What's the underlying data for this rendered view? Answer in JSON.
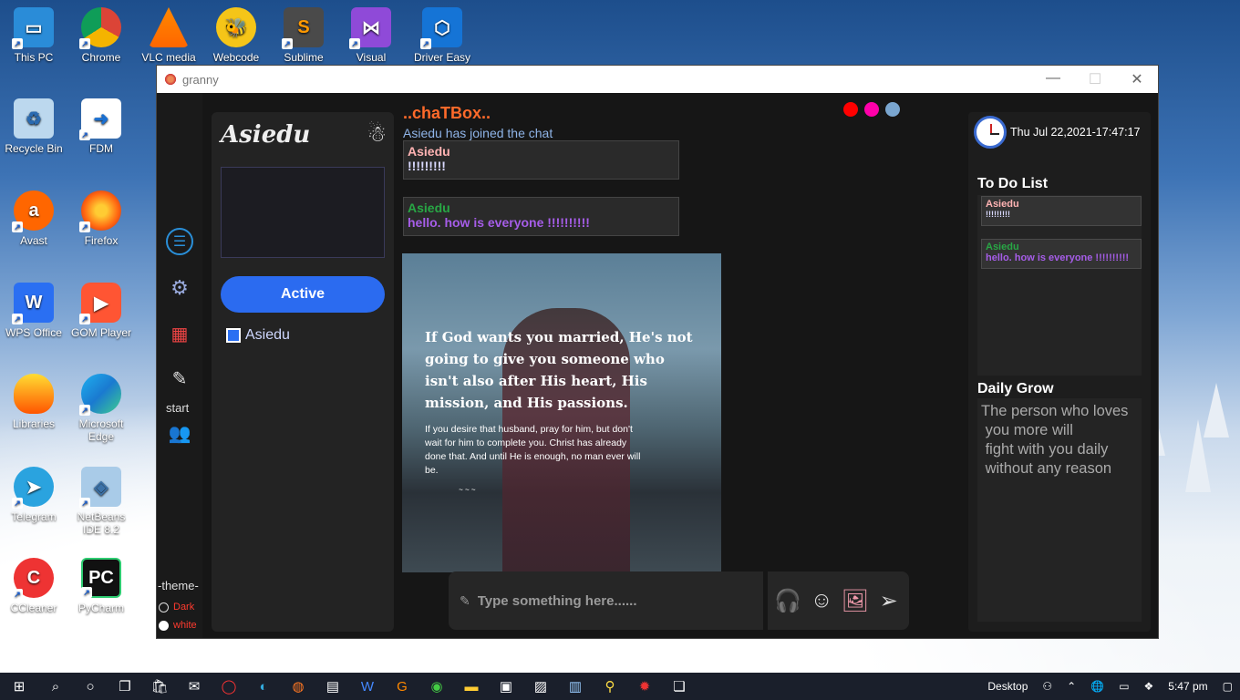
{
  "desktop": {
    "icons": [
      {
        "label": "This PC"
      },
      {
        "label": "Chrome"
      },
      {
        "label": "VLC media"
      },
      {
        "label": "Webcode"
      },
      {
        "label": "Sublime"
      },
      {
        "label": "Visual"
      },
      {
        "label": "Driver Easy"
      },
      {
        "label": "Recycle Bin"
      },
      {
        "label": "FDM"
      },
      {
        "label": "Avast"
      },
      {
        "label": "Firefox"
      },
      {
        "label": "WPS Office"
      },
      {
        "label": "GOM Player"
      },
      {
        "label": "Libraries"
      },
      {
        "label": "Microsoft Edge"
      },
      {
        "label": "Telegram"
      },
      {
        "label": "NetBeans IDE 8.2"
      },
      {
        "label": "CCleaner"
      },
      {
        "label": "PyCharm"
      }
    ]
  },
  "window": {
    "title": "granny"
  },
  "leftbar": {
    "start_label": "start",
    "theme_label": "-theme-",
    "theme_dark": "Dark",
    "theme_white": "white"
  },
  "userpanel": {
    "username": "Asiedu",
    "active_label": "Active",
    "online_users": [
      "Asiedu"
    ]
  },
  "chat": {
    "title": "..chaTBox..",
    "joined_text": "Asiedu has joined the chat",
    "messages": [
      {
        "sender": "Asiedu",
        "text": "!!!!!!!!!",
        "sender_color": "#ffb3b3",
        "text_color": "#d9d9ff"
      },
      {
        "sender": "Asiedu",
        "text": "hello. how is everyone !!!!!!!!!!",
        "sender_color": "#28a745",
        "text_color": "#a65de8"
      }
    ],
    "image_quote": "If God wants you married, He's not going to give you someone who isn't also after His heart, His mission, and His passions.",
    "image_subquote": "If you desire that husband, pray for him, but don't wait for him to complete you. Christ has already done that. And until He is enough, no man ever will be.",
    "input_placeholder": "Type something here......",
    "dot_colors": [
      "#ff0000",
      "#ff00aa",
      "#7aa6d0"
    ]
  },
  "rightpanel": {
    "datetime": "Thu Jul 22,2021-17:47:17",
    "todo_title": "To Do List",
    "todo_items": [
      {
        "sender": "Asiedu",
        "text": "!!!!!!!!!",
        "sender_color": "#ffb3b3",
        "text_color": "#d9d9ff"
      },
      {
        "sender": "Asiedu",
        "text": "hello. how is everyone !!!!!!!!!!",
        "sender_color": "#28a745",
        "text_color": "#a65de8"
      }
    ],
    "grow_title": "Daily Grow",
    "grow_lines": [
      "The person who loves",
      " you more will",
      " fight with you daily",
      " without any reason"
    ]
  },
  "taskbar": {
    "desktop_label": "Desktop",
    "time": "5:47 pm"
  }
}
